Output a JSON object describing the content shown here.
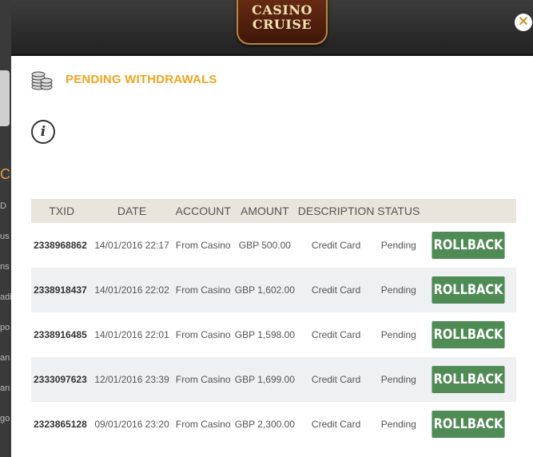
{
  "background": {
    "fragments": [
      "CO",
      "D",
      "us",
      "ns",
      "adi",
      "po",
      "an",
      "an",
      "go"
    ]
  },
  "header": {
    "logo_line1": "CASINO",
    "logo_line2": "CRUISE",
    "close_label": "✕"
  },
  "page": {
    "title": "PENDING WITHDRAWALS",
    "info_label": "i"
  },
  "table": {
    "columns": [
      "TXID",
      "DATE",
      "ACCOUNT",
      "AMOUNT",
      "DESCRIPTION",
      "STATUS"
    ],
    "rows": [
      {
        "txid": "2338968862",
        "date": "14/01/2016 22:17",
        "account": "From Casino",
        "amount": "GBP 500.00",
        "description": "Credit Card",
        "status": "Pending",
        "action": "ROLLBACK"
      },
      {
        "txid": "2338918437",
        "date": "14/01/2016 22:02",
        "account": "From Casino",
        "amount": "GBP 1,602.00",
        "description": "Credit Card",
        "status": "Pending",
        "action": "ROLLBACK"
      },
      {
        "txid": "2338916485",
        "date": "14/01/2016 22:01",
        "account": "From Casino",
        "amount": "GBP 1,598.00",
        "description": "Credit Card",
        "status": "Pending",
        "action": "ROLLBACK"
      },
      {
        "txid": "2333097623",
        "date": "12/01/2016 23:39",
        "account": "From Casino",
        "amount": "GBP 1,699.00",
        "description": "Credit Card",
        "status": "Pending",
        "action": "ROLLBACK"
      },
      {
        "txid": "2323865128",
        "date": "09/01/2016 23:20",
        "account": "From Casino",
        "amount": "GBP 2,300.00",
        "description": "Credit Card",
        "status": "Pending",
        "action": "ROLLBACK"
      }
    ]
  },
  "colors": {
    "title": "#f0a51e",
    "button": "#4f8b54",
    "header_row": "#e9e5dc",
    "alt_row": "#eef0f2"
  }
}
